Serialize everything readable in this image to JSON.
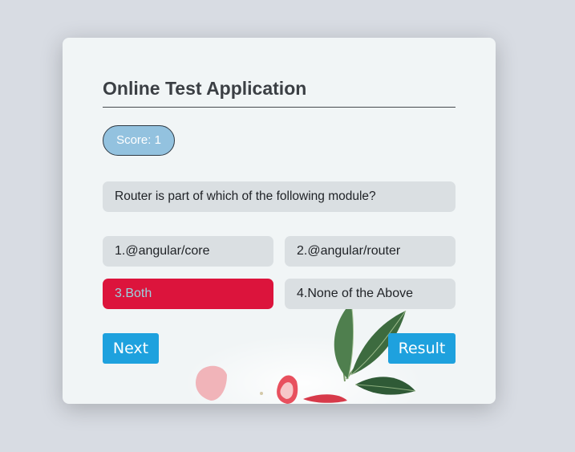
{
  "app": {
    "title": "Online Test Application"
  },
  "score": {
    "label": "Score: 1"
  },
  "question": {
    "text": "Router is part of which of the following module?"
  },
  "options": [
    {
      "label": "1.@angular/core",
      "selected": false
    },
    {
      "label": "2.@angular/router",
      "selected": false
    },
    {
      "label": "3.Both",
      "selected": true
    },
    {
      "label": "4.None of the Above",
      "selected": false
    }
  ],
  "buttons": {
    "next_label": "Next",
    "result_label": "Result"
  },
  "colors": {
    "page_background": "#d8dce3",
    "card_background": "#f1f5f6",
    "score_pill": "#93c2df",
    "option_background": "#dadfe2",
    "selected_option": "#dc143c",
    "selected_option_text": "#9ad3e0",
    "button": "#1ea1de"
  }
}
